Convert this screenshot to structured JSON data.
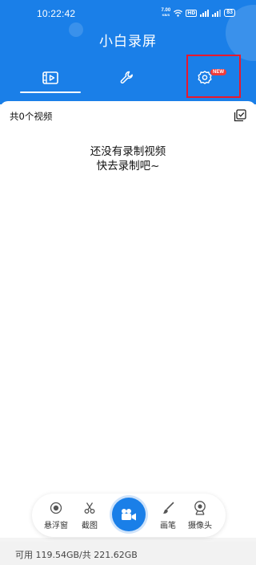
{
  "status_bar": {
    "time": "10:22:42",
    "net_speed_value": "7.00",
    "net_speed_unit": "KB/S",
    "hd_label": "HD",
    "battery": "83"
  },
  "app": {
    "title": "小白录屏"
  },
  "tabs": [
    {
      "name": "videos",
      "icon": "video-icon",
      "active": true
    },
    {
      "name": "tools",
      "icon": "wrench-icon"
    },
    {
      "name": "settings",
      "icon": "gear-icon",
      "badge": "NEW"
    }
  ],
  "video_list": {
    "count_label": "共0个视频",
    "empty_line1": "还没有录制视频",
    "empty_line2": "快去录制吧~"
  },
  "toolbar": {
    "floating_window": "悬浮窗",
    "screenshot": "截图",
    "brush": "画笔",
    "camera": "摄像头"
  },
  "storage": {
    "text": "可用 119.54GB/共 221.62GB"
  },
  "colors": {
    "primary": "#1a7fe8",
    "badge": "#ef3b3b",
    "highlight": "#e8182d"
  }
}
